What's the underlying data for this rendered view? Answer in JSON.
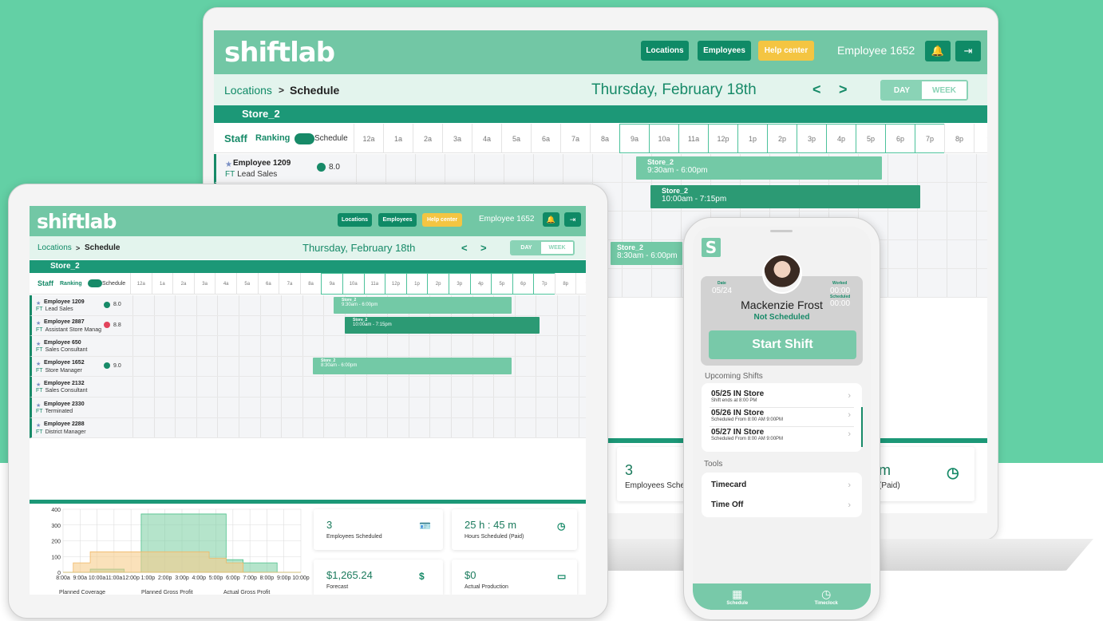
{
  "app": {
    "logo": "shiftlab",
    "nav": {
      "locations": "Locations",
      "employees": "Employees",
      "help": "Help center"
    },
    "user": "Employee 1652",
    "bell": "bell-icon",
    "logout": "logout-icon"
  },
  "sub": {
    "crumb_link": "Locations",
    "crumb_sep": ">",
    "crumb_current": "Schedule",
    "date": "Thursday, February 18th",
    "prev": "<",
    "next": ">",
    "day": "DAY",
    "week": "WEEK"
  },
  "store": "Store_2",
  "grid": {
    "staff": "Staff",
    "ranking": "Ranking",
    "schedule": "Schedule",
    "hours": [
      "12a",
      "1a",
      "2a",
      "3a",
      "4a",
      "5a",
      "6a",
      "7a",
      "8a",
      "9a",
      "10a",
      "11a",
      "12p",
      "1p",
      "2p",
      "3p",
      "4p",
      "5p",
      "6p",
      "7p",
      "8p",
      "9"
    ]
  },
  "employees": [
    {
      "name": "Employee 1209",
      "type": "FT",
      "role": "Lead Sales",
      "hours": "8.0",
      "clock": "green"
    },
    {
      "name": "Employee 2887",
      "type": "FT",
      "role": "Assistant Store Manag",
      "hours": "8.8",
      "clock": "red"
    },
    {
      "name": "Employee 650",
      "type": "FT",
      "role": "Sales Consultant",
      "hours": ""
    },
    {
      "name": "Employee 1652",
      "type": "FT",
      "role": "Store Manager",
      "hours": "9.0",
      "clock": "green"
    },
    {
      "name": "Employee 2132",
      "type": "FT",
      "role": "Sales Consultant",
      "hours": ""
    },
    {
      "name": "Employee 2330",
      "type": "FT",
      "role": "Terminated",
      "hours": ""
    },
    {
      "name": "Employee 2288",
      "type": "FT",
      "role": "District Manager",
      "hours": ""
    }
  ],
  "shifts": [
    {
      "store": "Store_2",
      "time": "9:30am - 6:00pm"
    },
    {
      "store": "Store_2",
      "time": "10:00am - 7:15pm"
    },
    {
      "store": "Store_2",
      "time": "8:30am - 6:00pm"
    }
  ],
  "chart_data": {
    "type": "area",
    "x": [
      "8:00a",
      "9:00a",
      "10:00a",
      "11:00a",
      "12:00p",
      "1:00p",
      "2:00p",
      "3:00p",
      "4:00p",
      "5:00p",
      "6:00p",
      "7:00p",
      "8:00p",
      "9:00p",
      "10:00p"
    ],
    "ylim": [
      0,
      400
    ],
    "yticks": [
      "400",
      "300",
      "200",
      "100",
      "0"
    ],
    "series": [
      {
        "name": "Planned Coverage",
        "values": [
          0,
          0,
          20,
          20,
          0,
          370,
          370,
          370,
          370,
          370,
          80,
          60,
          60,
          0,
          0
        ]
      },
      {
        "name": "Planned Gross Profit",
        "values": [
          0,
          60,
          130,
          130,
          130,
          130,
          130,
          130,
          130,
          90,
          60,
          0,
          0,
          0,
          0
        ]
      },
      {
        "name": "Actual Gross Profit",
        "values": [
          0,
          0,
          0,
          0,
          0,
          120,
          120,
          120,
          120,
          120,
          0,
          0,
          0,
          0,
          0
        ]
      }
    ],
    "legend": [
      "Planned Coverage",
      "Planned Gross Profit",
      "Actual Gross Profit"
    ]
  },
  "stats": [
    {
      "value": "3",
      "label": "Employees Scheduled",
      "icon": "id-card-icon"
    },
    {
      "value": "25 h : 45 m",
      "label": "Hours Scheduled (Paid)",
      "icon": "clock-icon"
    },
    {
      "value": "$1,265.24",
      "label": "Forecast",
      "icon": "money-hand-icon"
    },
    {
      "value": "$0",
      "label": "Actual Production",
      "icon": "cash-icon"
    }
  ],
  "laptop_stats": {
    "value": "3",
    "label": "Employees Sche",
    "right_value": "m",
    "right_label": "(Paid)"
  },
  "phone": {
    "logo": "S",
    "date_label": "Date",
    "date": "05/24",
    "worked_label": "Worked",
    "worked": "00:00",
    "scheduled_label": "Scheduled",
    "scheduled": "00:00",
    "name": "Mackenzie Frost",
    "status": "Not Scheduled",
    "start": "Start Shift",
    "upcoming_title": "Upcoming Shifts",
    "upcoming": [
      {
        "title": "05/25  IN Store",
        "sub": "Shift ends at 8:00 PM"
      },
      {
        "title": "05/26  IN Store",
        "sub": "Scheduled From 8:00 AM   9:00PM"
      },
      {
        "title": "05/27  IN Store",
        "sub": "Scheduled From 8:00 AM   9:00PM"
      }
    ],
    "tools_title": "Tools",
    "tools": [
      "Timecard",
      "Time Off"
    ],
    "tabs": [
      {
        "label": "Schedule",
        "icon": "calendar-icon"
      },
      {
        "label": "Timeclock",
        "icon": "clock-icon"
      }
    ]
  }
}
